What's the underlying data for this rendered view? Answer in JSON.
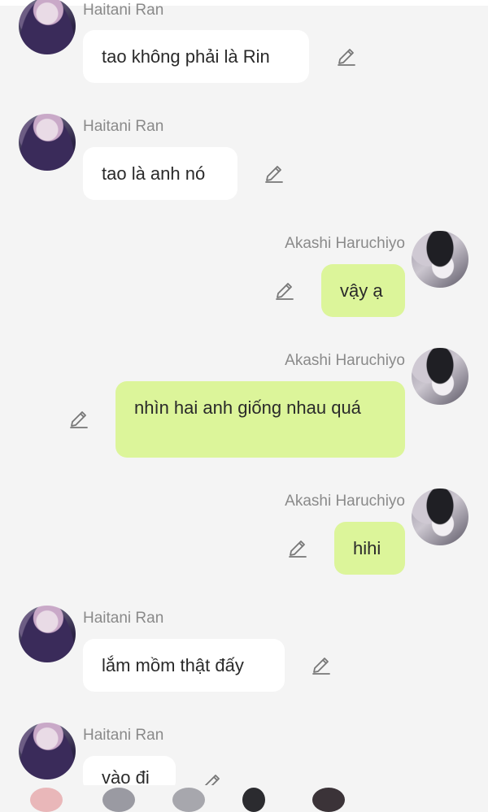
{
  "chat": {
    "messages": [
      {
        "sender": "Haitani Ran",
        "text": "tao không phải là Rin",
        "side": "left"
      },
      {
        "sender": "Haitani Ran",
        "text": "tao là anh nó",
        "side": "left"
      },
      {
        "sender": "Akashi Haruchiyo",
        "text": "vậy ạ",
        "side": "right"
      },
      {
        "sender": "Akashi Haruchiyo",
        "text": "nhìn hai anh giống nhau quá",
        "side": "right"
      },
      {
        "sender": "Akashi Haruchiyo",
        "text": "hihi",
        "side": "right"
      },
      {
        "sender": "Haitani Ran",
        "text": "lắm mồm thật đấy",
        "side": "left"
      },
      {
        "sender": "Haitani Ran",
        "text": "vào đi",
        "side": "left"
      }
    ]
  },
  "colors": {
    "background": "#f4f4f4",
    "left_bubble": "#ffffff",
    "right_bubble": "#dcf59a",
    "name_text": "#8a8a8a"
  },
  "icons": {
    "edit": "pencil-icon"
  }
}
